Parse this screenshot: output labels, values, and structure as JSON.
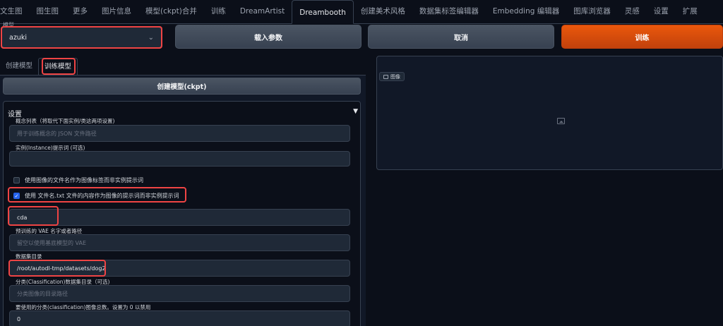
{
  "tabs": [
    {
      "label": "文生图"
    },
    {
      "label": "图生图"
    },
    {
      "label": "更多"
    },
    {
      "label": "图片信息"
    },
    {
      "label": "模型(ckpt)合并"
    },
    {
      "label": "训练"
    },
    {
      "label": "DreamArtist"
    },
    {
      "label": "Dreambooth",
      "active": true
    },
    {
      "label": "创建美术风格"
    },
    {
      "label": "数据集标签编辑器"
    },
    {
      "label": "Embedding 编辑器"
    },
    {
      "label": "图库浏览器"
    },
    {
      "label": "灵感"
    },
    {
      "label": "设置"
    },
    {
      "label": "扩展"
    }
  ],
  "model": {
    "label": "模型",
    "value": "azuki"
  },
  "buttons": {
    "load_params": "载入参数",
    "cancel": "取消",
    "train": "训练"
  },
  "subtabs": [
    {
      "label": "创建模型"
    },
    {
      "label": "训练模型",
      "active": true
    }
  ],
  "create_ckpt_label": "创建模型(ckpt)",
  "settings": {
    "title": "设置",
    "concepts_label": "概念列表（将取代下面实例/类这两项设置)",
    "concepts_placeholder": "用于训练概念的 JSON 文件路径",
    "instance_prompt_label": "实例(Instance)提示词 (可选)",
    "instance_prompt_value": "",
    "check_filename_label": "使用图像的文件名作为图像标签而非实例提示词",
    "check_filename_checked": false,
    "check_txt_label": "使用 文件名.txt 文件的内容作为图像的提示词而非实例提示词",
    "check_txt_checked": true,
    "instance_token_value": "cda",
    "vae_label": "预训练的 VAE 名字或者路径",
    "vae_placeholder": "留空以使用基底模型的 VAE",
    "dataset_label": "数据集目录",
    "dataset_value": "/root/autodl-tmp/datasets/dog2",
    "class_dir_label": "分类(Classification)数据集目录（可选)",
    "class_dir_placeholder": "分类图像的目录路径",
    "class_count_label": "要使用的分类(classification)图像总数。设置为 0 以禁用",
    "class_count_value": "0"
  },
  "image_panel": {
    "label": "图像"
  },
  "colors": {
    "accent": "#c2410c",
    "highlight": "#ef4444",
    "background": "#0b0f19"
  }
}
